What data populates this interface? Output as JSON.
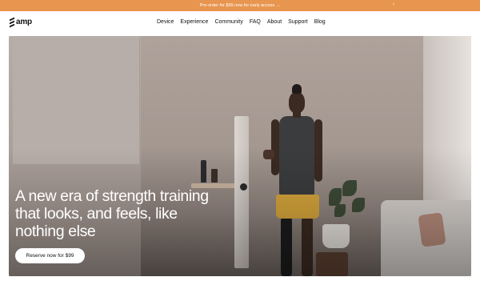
{
  "promo_bar": {
    "text": "Pre-order for $99 now for early access →",
    "close_glyph": "‹",
    "background": "#e8954f"
  },
  "header": {
    "logo_text": "amp",
    "logo_icon": "amp-logo-icon",
    "nav_items": [
      {
        "label": "Device"
      },
      {
        "label": "Experience"
      },
      {
        "label": "Community"
      },
      {
        "label": "FAQ"
      },
      {
        "label": "About"
      },
      {
        "label": "Support"
      },
      {
        "label": "Blog"
      }
    ]
  },
  "hero": {
    "headline": "A new era of strength training that looks, and feels, like nothing else",
    "cta_label": "Reserve now for $99"
  }
}
